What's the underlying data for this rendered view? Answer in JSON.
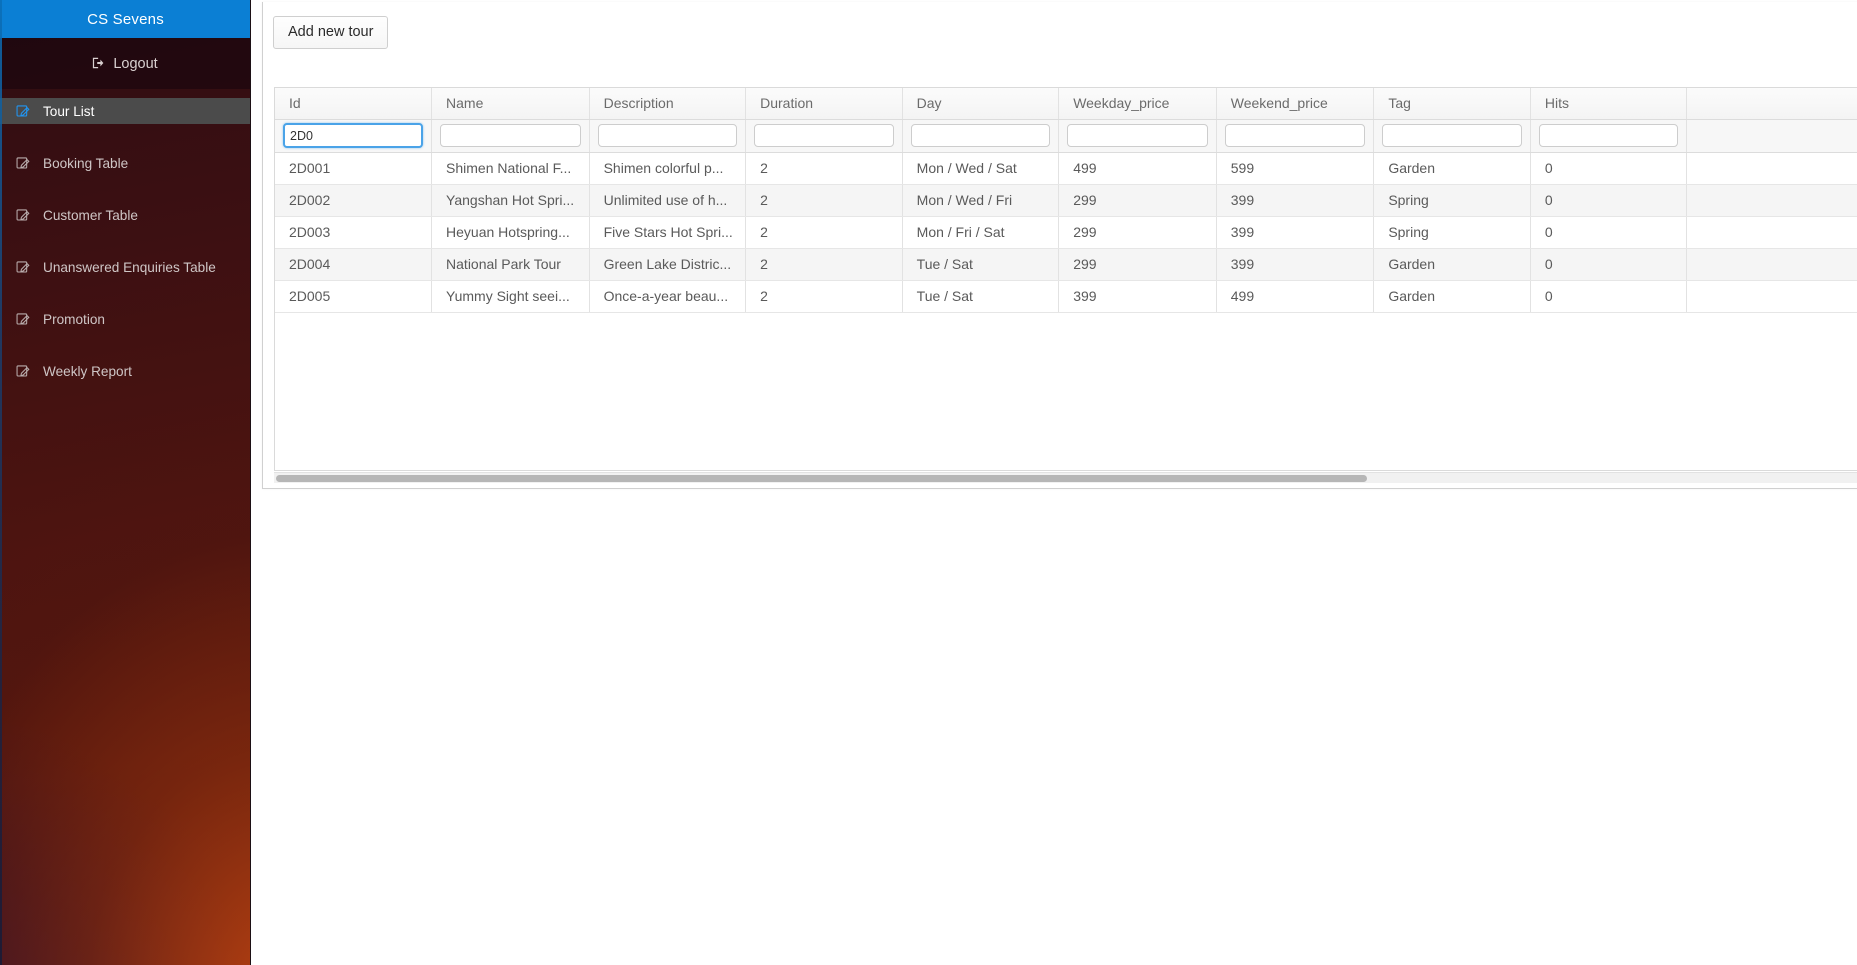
{
  "sidebar": {
    "brand": "CS Sevens",
    "logout": {
      "label": "Logout",
      "icon": "logout-icon"
    },
    "items": [
      {
        "label": "Tour List",
        "icon": "edit-icon",
        "active": true
      },
      {
        "label": "Booking Table",
        "icon": "edit-icon",
        "active": false
      },
      {
        "label": "Customer Table",
        "icon": "edit-icon",
        "active": false
      },
      {
        "label": "Unanswered Enquiries Table",
        "icon": "edit-icon",
        "active": false
      },
      {
        "label": "Promotion",
        "icon": "edit-icon",
        "active": false
      },
      {
        "label": "Weekly Report",
        "icon": "edit-icon",
        "active": false
      }
    ],
    "accent_blue": "#0b7fd4",
    "active_bg": "#4b4b4b"
  },
  "toolbar": {
    "add_tour_label": "Add new tour"
  },
  "table": {
    "columns": [
      {
        "key": "id",
        "label": "Id"
      },
      {
        "key": "name",
        "label": "Name"
      },
      {
        "key": "description",
        "label": "Description"
      },
      {
        "key": "duration",
        "label": "Duration"
      },
      {
        "key": "day",
        "label": "Day"
      },
      {
        "key": "weekday_price",
        "label": "Weekday_price"
      },
      {
        "key": "weekend_price",
        "label": "Weekend_price"
      },
      {
        "key": "tag",
        "label": "Tag"
      },
      {
        "key": "hits",
        "label": "Hits"
      }
    ],
    "filters": {
      "id": "2D0",
      "name": "",
      "description": "",
      "duration": "",
      "day": "",
      "weekday_price": "",
      "weekend_price": "",
      "tag": "",
      "hits": "",
      "focused_field": "id"
    },
    "rows": [
      {
        "id": "2D001",
        "name": "Shimen National F...",
        "description": "Shimen colorful p...",
        "duration": "2",
        "day": "Mon / Wed / Sat",
        "weekday_price": "499",
        "weekend_price": "599",
        "tag": "Garden",
        "hits": "0"
      },
      {
        "id": "2D002",
        "name": "Yangshan Hot Spri...",
        "description": "Unlimited use of h...",
        "duration": "2",
        "day": "Mon / Wed / Fri",
        "weekday_price": "299",
        "weekend_price": "399",
        "tag": "Spring",
        "hits": "0"
      },
      {
        "id": "2D003",
        "name": "Heyuan Hotspring...",
        "description": "Five Stars Hot Spri...",
        "duration": "2",
        "day": "Mon / Fri / Sat",
        "weekday_price": "299",
        "weekend_price": "399",
        "tag": "Spring",
        "hits": "0"
      },
      {
        "id": "2D004",
        "name": "National Park Tour",
        "description": "Green Lake Distric...",
        "duration": "2",
        "day": "Tue / Sat",
        "weekday_price": "299",
        "weekend_price": "399",
        "tag": "Garden",
        "hits": "0"
      },
      {
        "id": "2D005",
        "name": "Yummy Sight seei...",
        "description": "Once-a-year beau...",
        "duration": "2",
        "day": "Tue / Sat",
        "weekday_price": "399",
        "weekend_price": "499",
        "tag": "Garden",
        "hits": "0"
      }
    ]
  }
}
